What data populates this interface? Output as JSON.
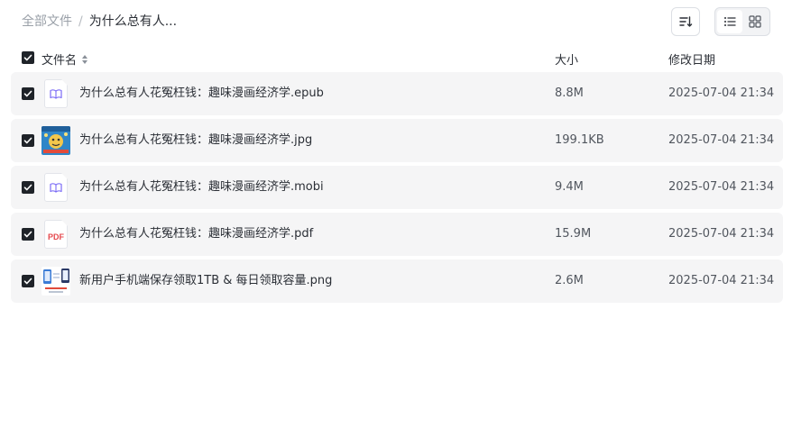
{
  "breadcrumb": {
    "root": "全部文件",
    "separator": "/",
    "current": "为什么总有人..."
  },
  "toolbar": {
    "sort_icon": "sort-icon",
    "view_list_icon": "list-view-icon",
    "view_grid_icon": "grid-view-icon",
    "active_view": "list"
  },
  "table": {
    "columns": {
      "name": "文件名",
      "size": "大小",
      "modified": "修改日期"
    },
    "select_all_checked": true,
    "rows": [
      {
        "name": "为什么总有人花冤枉钱：趣味漫画经济学.epub",
        "size": "8.8M",
        "modified": "2025-07-04 21:34",
        "type": "epub",
        "icon": "ebook-icon",
        "checked": true
      },
      {
        "name": "为什么总有人花冤枉钱：趣味漫画经济学.jpg",
        "size": "199.1KB",
        "modified": "2025-07-04 21:34",
        "type": "jpg",
        "icon": "image-thumbnail",
        "checked": true
      },
      {
        "name": "为什么总有人花冤枉钱：趣味漫画经济学.mobi",
        "size": "9.4M",
        "modified": "2025-07-04 21:34",
        "type": "mobi",
        "icon": "ebook-icon",
        "checked": true
      },
      {
        "name": "为什么总有人花冤枉钱：趣味漫画经济学.pdf",
        "size": "15.9M",
        "modified": "2025-07-04 21:34",
        "type": "pdf",
        "icon": "pdf-icon",
        "icon_text": "PDF",
        "checked": true
      },
      {
        "name": "新用户手机端保存领取1TB & 每日领取容量.png",
        "size": "2.6M",
        "modified": "2025-07-04 21:34",
        "type": "png",
        "icon": "image-thumbnail",
        "checked": true
      }
    ]
  },
  "colors": {
    "row_bg": "#f5f5f6",
    "checkbox": "#1f2329",
    "ebook_icon": "#7b6cf6",
    "pdf_icon": "#e5484d"
  }
}
